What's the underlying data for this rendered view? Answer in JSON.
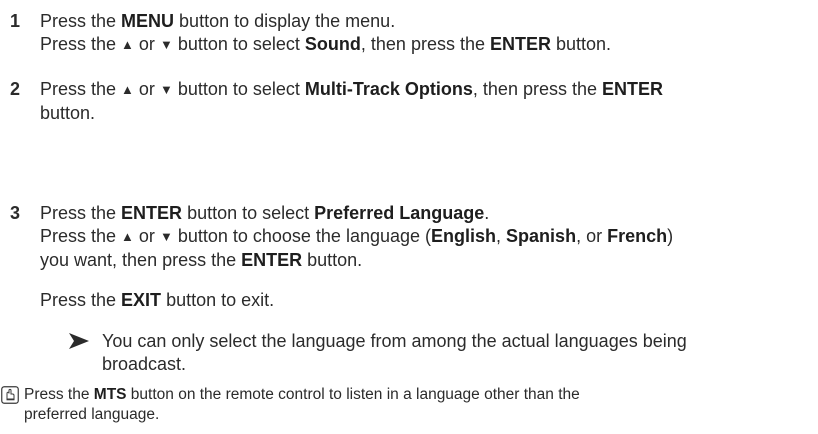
{
  "steps": [
    {
      "number": "1",
      "line1": {
        "a": "Press the ",
        "b": "MENU",
        "c": " button to display the menu."
      },
      "line2": {
        "a": "Press the ",
        "up": "▲",
        "or": " or ",
        "down": "▼",
        "b": " button to select ",
        "c": "Sound",
        "d": ", then press the ",
        "e": "ENTER",
        "f": " button."
      }
    },
    {
      "number": "2",
      "line1": {
        "a": "Press the ",
        "up": "▲",
        "or": " or ",
        "down": "▼",
        "b": " button to select ",
        "c": "Multi-Track Options",
        "d": ", then press the ",
        "e": "ENTER"
      },
      "line2": "button."
    },
    {
      "number": "3",
      "line1": {
        "a": "Press the ",
        "b": "ENTER",
        "c": " button to select ",
        "d": "Preferred Language",
        "e": "."
      },
      "line2": {
        "a": "Press the ",
        "up": "▲",
        "or": " or ",
        "down": "▼",
        "b": " button to choose the language (",
        "c": "English",
        "d": ", ",
        "e": "Spanish",
        "f": ", or ",
        "g": "French",
        "h": ")"
      },
      "line3": {
        "a": "you want, then press the ",
        "b": "ENTER",
        "c": " button."
      }
    }
  ],
  "exit": {
    "a": "Press the ",
    "b": "EXIT",
    "c": " button to exit."
  },
  "note": {
    "line1": "You can only select the language from among the actual languages being",
    "line2": "broadcast."
  },
  "remote_note": {
    "a": "Press the ",
    "b": "MTS",
    "c": " button on the remote control to listen in a language other than the",
    "line2": "preferred language."
  },
  "icons": {
    "note_arrow": "arrowhead-icon",
    "remote": "remote-hand-icon"
  },
  "colors": {
    "text": "#2b2b2b",
    "background": "#ffffff"
  }
}
